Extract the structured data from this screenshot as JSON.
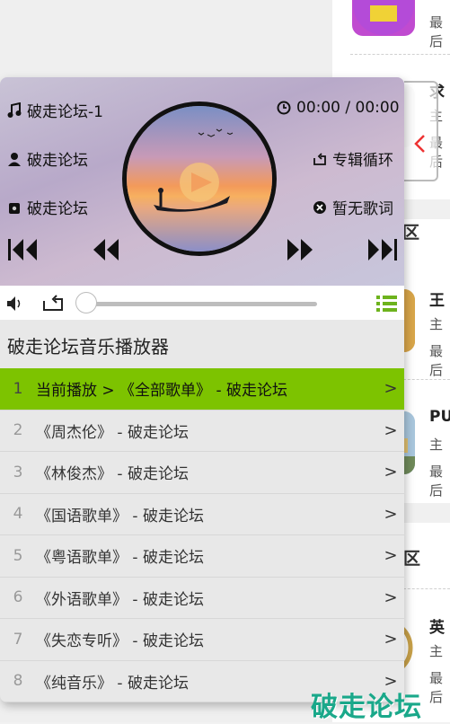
{
  "background": {
    "items": [
      {
        "title": "求",
        "sub1": "主",
        "sub2": "最后"
      },
      {
        "title": "王",
        "sub1": "主",
        "sub2": "最后"
      },
      {
        "title": "PU",
        "sub1": "主",
        "sub2": "最后"
      },
      {
        "title": "英",
        "sub1": "主",
        "sub2": "最后"
      }
    ],
    "top_sub": "最后",
    "section_mid": "游专区",
    "section_bottom": "端游专区"
  },
  "player": {
    "song_title": "破走论坛-1",
    "time": "00:00 / 00:00",
    "artist": "破走论坛",
    "loop_mode": "专辑循环",
    "album": "破走论坛",
    "lyrics_status": "暂无歌词",
    "progress": 0,
    "list_title": "破走论坛音乐播放器",
    "playlists": [
      {
        "num": "1",
        "text": "当前播放 > 《全部歌单》 - 破走论坛",
        "active": true
      },
      {
        "num": "2",
        "text": "《周杰伦》 - 破走论坛"
      },
      {
        "num": "3",
        "text": "《林俊杰》 - 破走论坛"
      },
      {
        "num": "4",
        "text": "《国语歌单》 - 破走论坛"
      },
      {
        "num": "5",
        "text": "《粤语歌单》 - 破走论坛"
      },
      {
        "num": "6",
        "text": "《外语歌单》 - 破走论坛"
      },
      {
        "num": "7",
        "text": "《失恋专听》 - 破走论坛"
      },
      {
        "num": "8",
        "text": "《纯音乐》 - 破走论坛"
      }
    ],
    "chevron": ">"
  },
  "watermark": "破走论坛",
  "colors": {
    "accent": "#7dc300",
    "watermark": "#1aa88a"
  },
  "icons": [
    "music-note-icon",
    "clock-icon",
    "user-icon",
    "loop-icon",
    "album-icon",
    "close-circle-icon",
    "skip-back-icon",
    "rewind-icon",
    "fast-forward-icon",
    "skip-forward-icon",
    "volume-icon",
    "repeat-icon",
    "playlist-icon"
  ]
}
